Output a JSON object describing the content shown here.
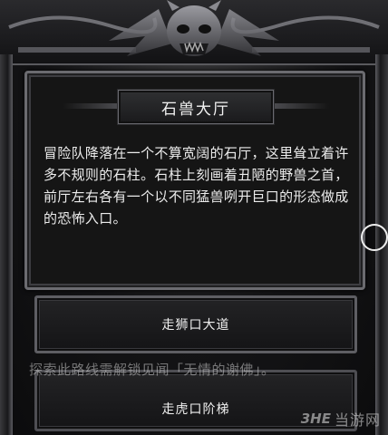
{
  "event": {
    "title": "石兽大厅",
    "description": "冒险队降落在一个不算宽阔的石厅，这里耸立着许多不规则的石柱。石柱上刻画着丑陋的野兽之首，前厅左右各有一个以不同猛兽咧开巨口的形态做成的恐怖入口。"
  },
  "options": [
    {
      "label": "走狮口大道"
    },
    {
      "label": "走虎口阶梯",
      "locked_note": "探索此路线需解锁见闻「无情的谢佛」。"
    }
  ],
  "watermark": {
    "logo": "3HE",
    "text": "当游网"
  },
  "icons": {
    "ornament": "demon-skull-ornament-icon",
    "side_button": "circle-icon"
  }
}
